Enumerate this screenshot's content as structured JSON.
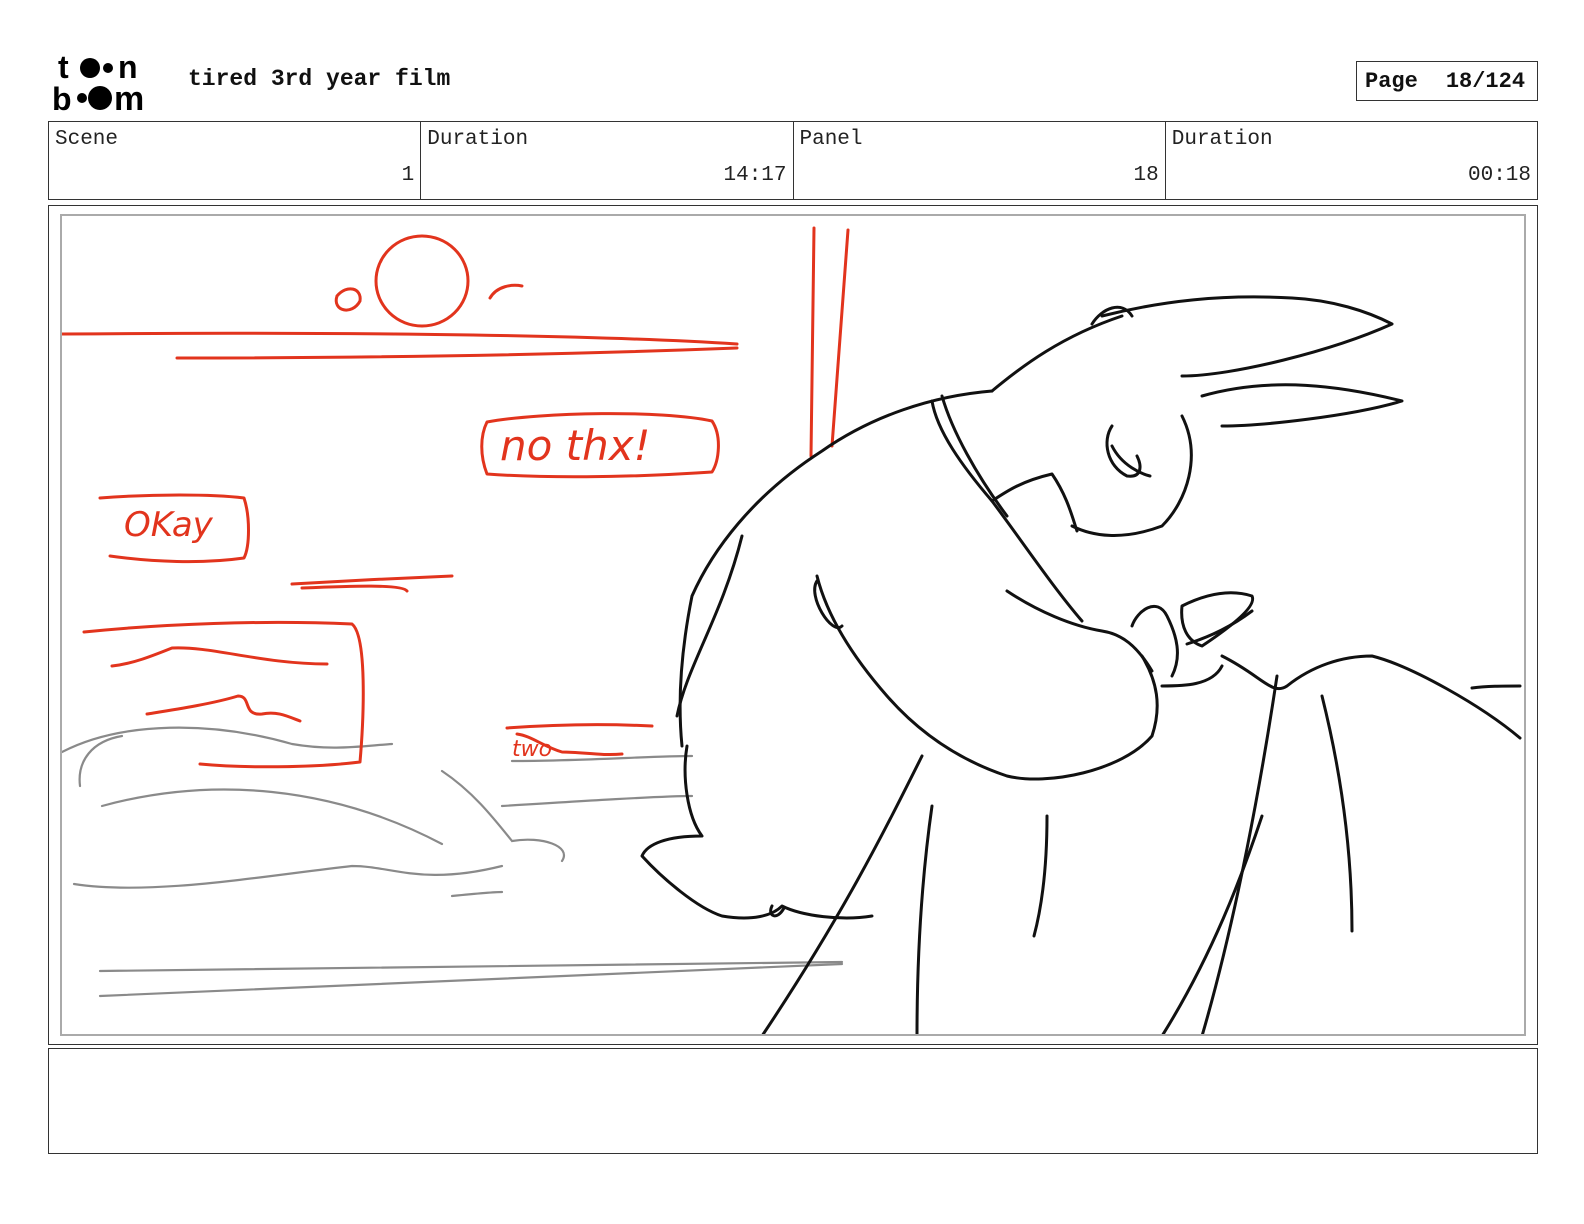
{
  "header": {
    "logo_text": "toon boom",
    "project_title": "tired 3rd year film",
    "page_label": "Page",
    "page_number": "18/124"
  },
  "info": {
    "scene_label": "Scene",
    "scene_value": "1",
    "scene_duration_label": "Duration",
    "scene_duration_value": "14:17",
    "panel_label": "Panel",
    "panel_value": "18",
    "panel_duration_label": "Duration",
    "panel_duration_value": "00:18"
  },
  "sketch": {
    "bubble_1_text": "no thx!",
    "bubble_2_text": "OKay",
    "scribble_text": "two",
    "colors": {
      "red": "#e2341d",
      "ink": "#111111",
      "gray": "#8a8a8a"
    }
  },
  "notes": {
    "text": ""
  }
}
